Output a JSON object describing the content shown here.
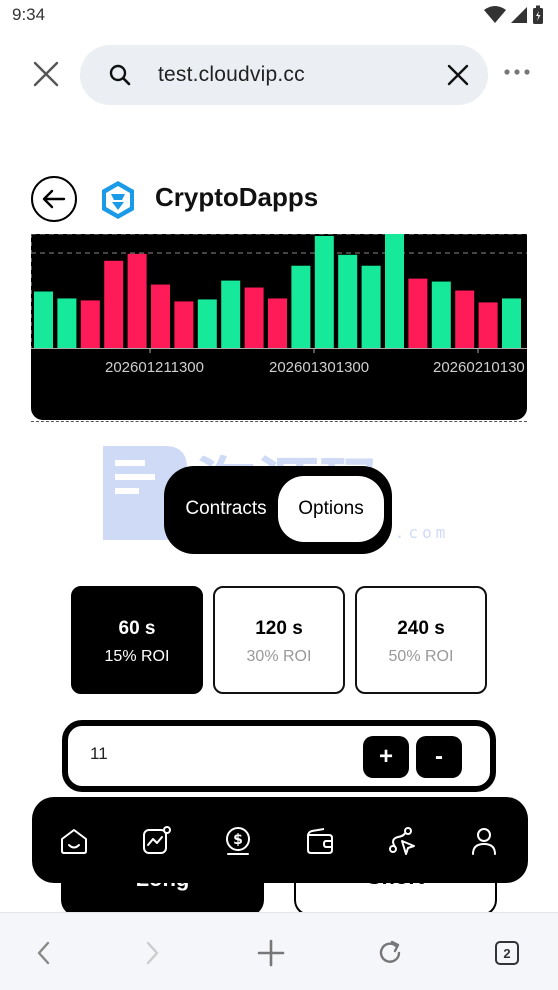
{
  "status_bar": {
    "time": "9:34"
  },
  "browser": {
    "url": "test.cloudvip.cc",
    "tabs_count": "2"
  },
  "header": {
    "title": "CryptoDapps"
  },
  "chart_data": {
    "type": "bar",
    "title": "",
    "x_tick_labels": [
      "202601211300",
      "202601301300",
      "20260210130"
    ],
    "grid": "dashed-horizontal",
    "colors": {
      "up": "#16e99a",
      "down": "#ff1a58"
    },
    "bars": [
      {
        "value": 57,
        "dir": "up"
      },
      {
        "value": 50,
        "dir": "up"
      },
      {
        "value": 48,
        "dir": "down"
      },
      {
        "value": 88,
        "dir": "down"
      },
      {
        "value": 95,
        "dir": "down"
      },
      {
        "value": 64,
        "dir": "down"
      },
      {
        "value": 47,
        "dir": "down"
      },
      {
        "value": 49,
        "dir": "up"
      },
      {
        "value": 68,
        "dir": "up"
      },
      {
        "value": 61,
        "dir": "down"
      },
      {
        "value": 50,
        "dir": "down"
      },
      {
        "value": 83,
        "dir": "up"
      },
      {
        "value": 113,
        "dir": "up"
      },
      {
        "value": 94,
        "dir": "up"
      },
      {
        "value": 83,
        "dir": "up"
      },
      {
        "value": 115,
        "dir": "up"
      },
      {
        "value": 70,
        "dir": "down"
      },
      {
        "value": 67,
        "dir": "up"
      },
      {
        "value": 58,
        "dir": "down"
      },
      {
        "value": 46,
        "dir": "down"
      },
      {
        "value": 50,
        "dir": "up"
      }
    ],
    "ylim": [
      0,
      115
    ]
  },
  "watermark": {
    "cn": "淘源码",
    "en": "taoymw.com"
  },
  "trade_mode": {
    "contracts_label": "Contracts",
    "options_label": "Options",
    "selected": "Options"
  },
  "durations": [
    {
      "time": "60 s",
      "roi": "15% ROI",
      "selected": true
    },
    {
      "time": "120 s",
      "roi": "30% ROI",
      "selected": false
    },
    {
      "time": "240 s",
      "roi": "50% ROI",
      "selected": false
    }
  ],
  "amount": {
    "value": "11",
    "plus_label": "+",
    "minus_label": "-"
  },
  "actions": {
    "long_label": "Long",
    "short_label": "Short"
  },
  "tab_bar": {
    "icons": [
      "home-icon",
      "chart-icon",
      "dollar-coin-icon",
      "wallet-icon",
      "route-icon",
      "user-icon"
    ]
  }
}
